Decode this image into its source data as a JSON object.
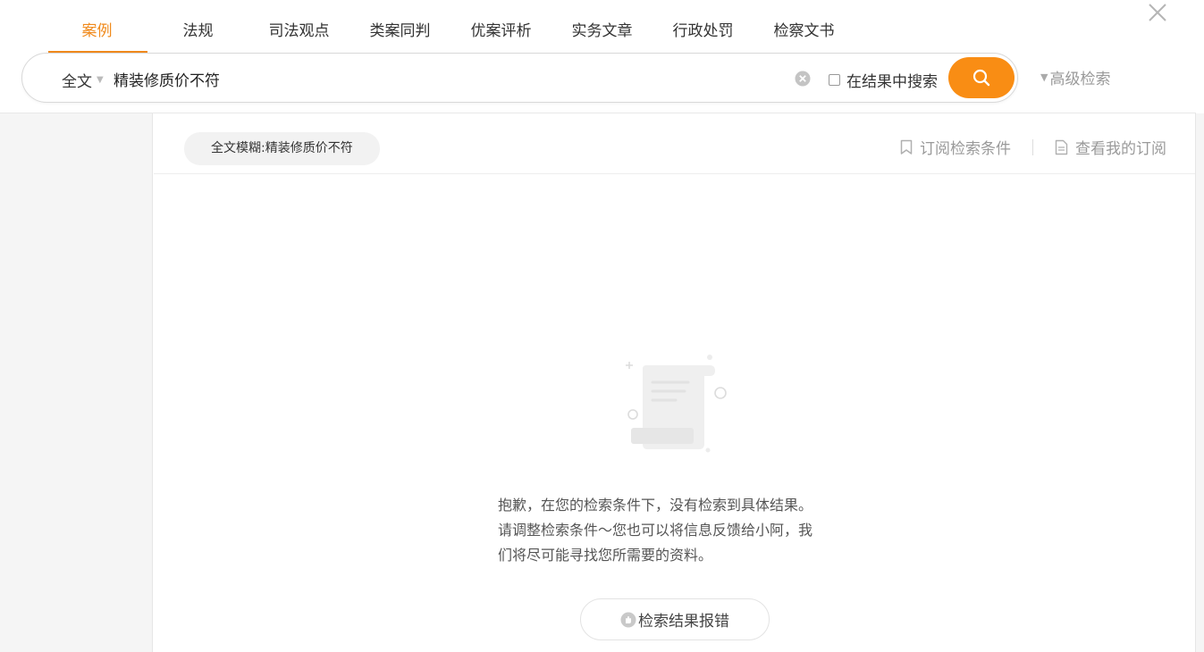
{
  "tabs": [
    {
      "label": "案例",
      "active": true
    },
    {
      "label": "法规",
      "active": false
    },
    {
      "label": "司法观点",
      "active": false
    },
    {
      "label": "类案同判",
      "active": false
    },
    {
      "label": "优案评析",
      "active": false
    },
    {
      "label": "实务文章",
      "active": false
    },
    {
      "label": "行政处罚",
      "active": false
    },
    {
      "label": "检察文书",
      "active": false
    }
  ],
  "search": {
    "scope": "全文",
    "query": "精装修质价不符",
    "in_results_label": "在结果中搜索",
    "in_results_checked": false,
    "advanced_label": "高级检索"
  },
  "filter": {
    "chip": "全文模糊:精装修质价不符"
  },
  "actions": {
    "subscribe": "订阅检索条件",
    "view_subscriptions": "查看我的订阅"
  },
  "empty_state": {
    "lines": [
      "抱歉，在您的检索条件下，没有检索到具体结果。",
      "请调整检索条件～您也可以将信息反馈给小阿，我",
      "们将尽可能寻找您所需要的资料。"
    ],
    "report_button": "检索结果报错"
  },
  "colors": {
    "accent": "#f08a1c",
    "search_button": "#f98d14",
    "muted_text": "#9a9a9a",
    "sidebar_bg": "#f5f5f5"
  },
  "icons": {
    "close": "close-icon",
    "clear": "clear-icon",
    "search": "search-icon",
    "bookmark": "bookmark-icon",
    "document": "document-icon",
    "hand": "hand-icon"
  }
}
